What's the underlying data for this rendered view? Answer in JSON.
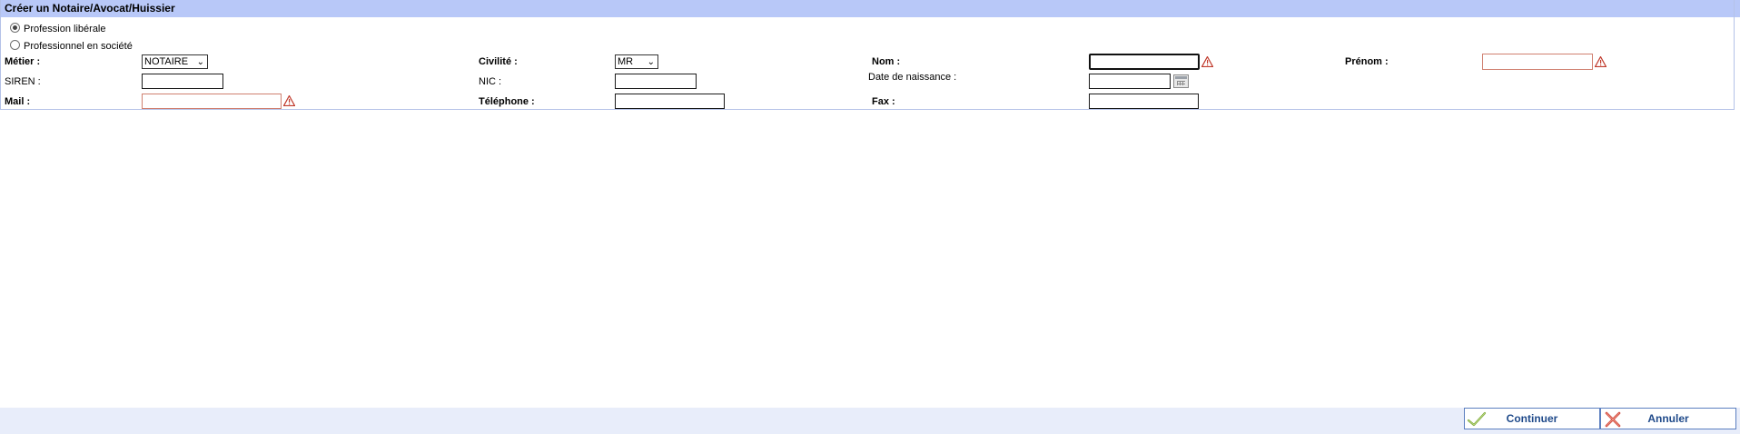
{
  "title": "Créer un Notaire/Avocat/Huissier",
  "radios": {
    "liberal": "Profession libérale",
    "societe": "Professionnel en société"
  },
  "fields": {
    "metier_label": "Métier :",
    "metier_value": "NOTAIRE",
    "civilite_label": "Civilité :",
    "civilite_value": "MR",
    "nom_label": "Nom :",
    "prenom_label": "Prénom :",
    "siren_label": "SIREN :",
    "nic_label": "NIC :",
    "naissance_label": "Date de naissance :",
    "mail_label": "Mail :",
    "telephone_label": "Téléphone :",
    "fax_label": "Fax :"
  },
  "buttons": {
    "continuer": "Continuer",
    "annuler": "Annuler"
  },
  "icons": {
    "warning": "warning-icon",
    "calendar": "calendar-icon",
    "check": "check-icon",
    "cross": "cross-icon"
  },
  "colors": {
    "title_bar": "#b8c8f8",
    "required_border": "#d08070",
    "warning": "#c0392b",
    "button_text": "#1f4a8a",
    "footer": "#e8edfa"
  }
}
